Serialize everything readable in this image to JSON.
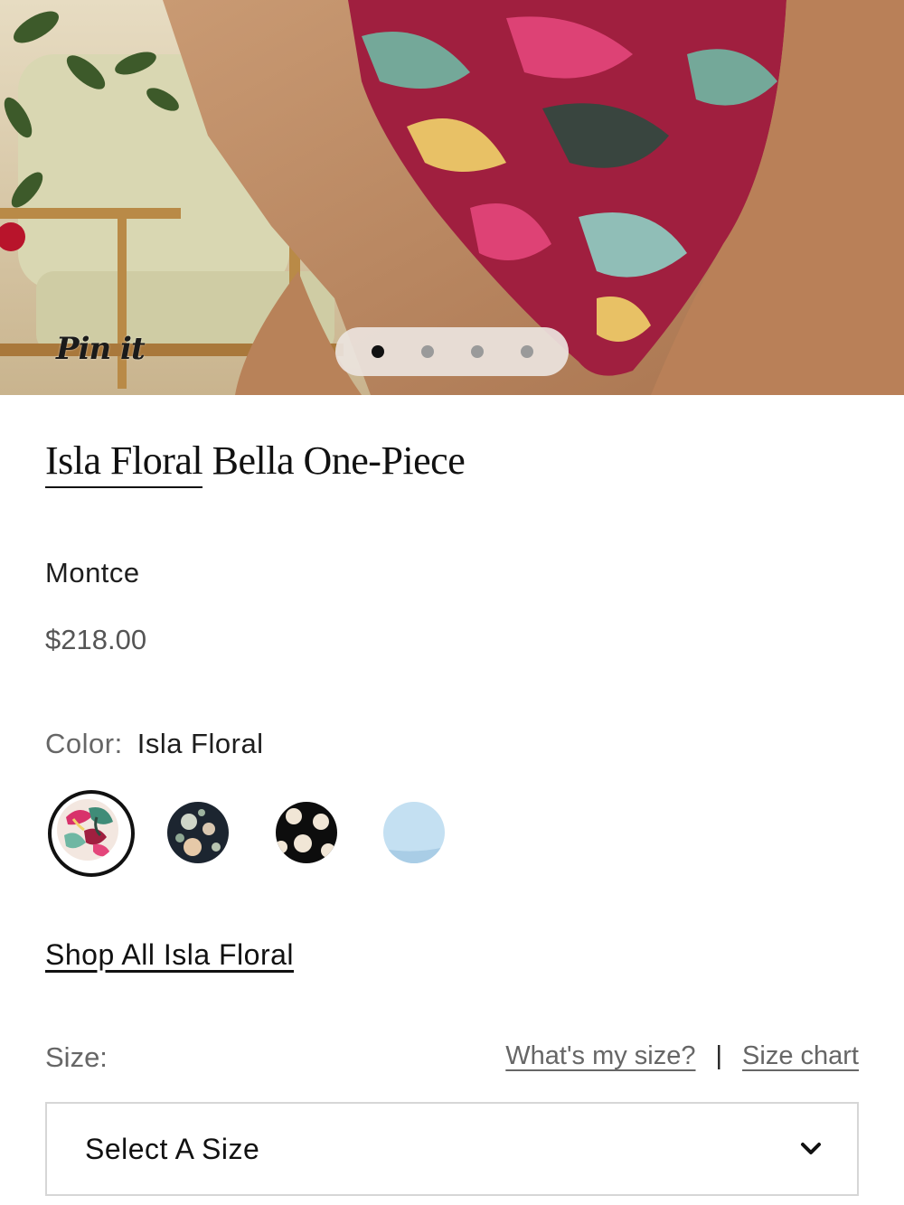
{
  "hero": {
    "pin_label": "Pin it",
    "carousel": {
      "total": 4,
      "active_index": 0
    }
  },
  "product": {
    "title_brand": "Isla Floral",
    "title_rest": " Bella One-Piece",
    "brand": "Montce",
    "price": "$218.00"
  },
  "color": {
    "label": "Color:",
    "selected": "Isla Floral",
    "swatches": [
      {
        "name": "isla-floral",
        "selected": true
      },
      {
        "name": "dark-floral",
        "selected": false
      },
      {
        "name": "black-polka-dot",
        "selected": false
      },
      {
        "name": "light-blue",
        "selected": false
      }
    ]
  },
  "shop_all": "Shop All Isla Floral",
  "size": {
    "label": "Size:",
    "whats_my_size": "What's my size?",
    "separator": "|",
    "size_chart": "Size chart",
    "select_placeholder": "Select A Size"
  },
  "icons": {
    "select": "chevron-down-icon"
  }
}
